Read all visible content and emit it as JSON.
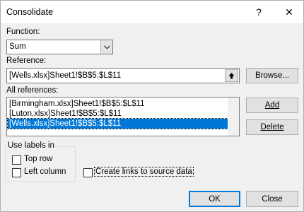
{
  "dialog": {
    "title": "Consolidate",
    "help_glyph": "?",
    "close_glyph": "✕"
  },
  "function": {
    "label": "Function:",
    "selected": "Sum",
    "arrow_icon": "chevron-down-icon"
  },
  "reference": {
    "label": "Reference:",
    "value": "[Wells.xlsx]Sheet1!$B$5:$L$11",
    "collapse_icon": "arrow-up-icon",
    "browse_label": "Browse..."
  },
  "all_references": {
    "label": "All references:",
    "items": [
      "[Birmingham.xlsx]Sheet1!$B$5:$L$11",
      "[Luton.xlsx]Sheet1!$B$5:$L$11",
      "[Wells.xlsx]Sheet1!$B$5:$L$11"
    ],
    "selected_index": 2,
    "add_label": "Add",
    "delete_label": "Delete"
  },
  "use_labels": {
    "title": "Use labels in",
    "top_row": "Top row",
    "left_column": "Left column",
    "top_row_checked": false,
    "left_column_checked": false
  },
  "links": {
    "label": "Create links to source data",
    "checked": false
  },
  "footer": {
    "ok_label": "OK",
    "close_label": "Close"
  },
  "colors": {
    "accent": "#0078d7",
    "dialog_bg": "#f0f0f0"
  }
}
